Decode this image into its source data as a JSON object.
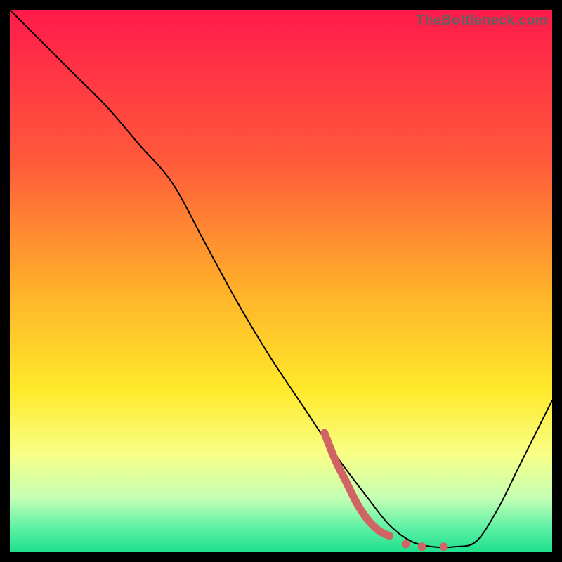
{
  "watermark": "TheBottleneck.com",
  "chart_data": {
    "type": "line",
    "title": "",
    "xlabel": "",
    "ylabel": "",
    "xlim": [
      0,
      100
    ],
    "ylim": [
      0,
      100
    ],
    "grid": false,
    "legend": false,
    "gradient_stops": [
      {
        "offset": 0.0,
        "color": "#ff1a4b"
      },
      {
        "offset": 0.28,
        "color": "#ff5a3a"
      },
      {
        "offset": 0.52,
        "color": "#ffb22a"
      },
      {
        "offset": 0.7,
        "color": "#ffe92a"
      },
      {
        "offset": 0.82,
        "color": "#f8ff86"
      },
      {
        "offset": 0.9,
        "color": "#c4ffb4"
      },
      {
        "offset": 0.95,
        "color": "#66f2a8"
      },
      {
        "offset": 1.0,
        "color": "#1ee08c"
      }
    ],
    "curve": {
      "name": "bottleneck-curve",
      "color": "#000000",
      "width": 2,
      "x": [
        0,
        6,
        12,
        18,
        24,
        30,
        36,
        42,
        48,
        54,
        60,
        66,
        70,
        74,
        78,
        82,
        86,
        90,
        94,
        100
      ],
      "y": [
        100,
        94,
        88,
        82,
        75,
        68,
        57,
        46,
        36,
        27,
        18,
        10,
        5,
        2,
        1,
        1,
        2,
        8,
        16,
        28
      ]
    },
    "highlight": {
      "name": "highlight-segment",
      "color": "#d06464",
      "width": 11,
      "cap": "round",
      "x": [
        58,
        60,
        62,
        64,
        66,
        68,
        70
      ],
      "y": [
        22,
        17,
        13,
        9,
        6,
        4,
        3
      ]
    },
    "highlight_dots": {
      "name": "highlight-dots",
      "color": "#d06464",
      "r": 6,
      "points": [
        {
          "x": 73,
          "y": 1.5
        },
        {
          "x": 76,
          "y": 1.0
        },
        {
          "x": 80,
          "y": 1.0
        }
      ]
    }
  }
}
